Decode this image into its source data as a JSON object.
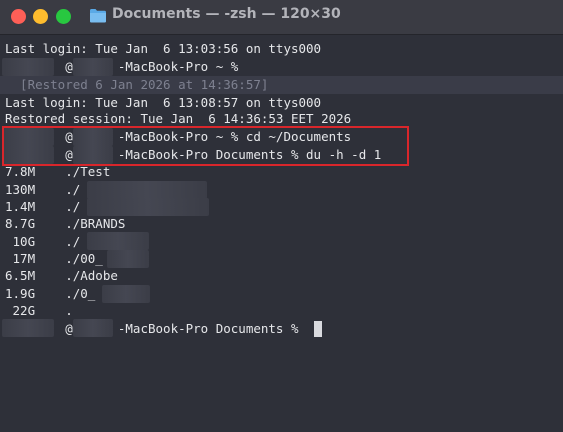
{
  "window": {
    "title": "Documents — -zsh — 120×30",
    "folder_icon": "folder-icon"
  },
  "colors": {
    "background": "#2e3039",
    "text": "#e6e7ea",
    "restored": "#7e8190",
    "highlight": "#d9262b"
  },
  "terminal": {
    "lines": [
      "Last login: Tue Jan  6 13:03:56 on ttys000",
      "        @M     -MacBook-Pro ~ %",
      "  [Restored 6 Jan 2026 at 14:36:57]",
      "Last login: Tue Jan  6 13:08:57 on ttys000",
      "Restored session: Tue Jan  6 14:36:53 EET 2026",
      "        @M     -MacBook-Pro ~ % cd ~/Documents",
      "        @M     -MacBook-Pro Documents % du -h -d 1",
      "7.8M    ./Test",
      "130M    ./",
      "1.4M    ./",
      "8.7G    ./BRANDS",
      " 10G    ./",
      " 17M    ./00_",
      "6.5M    ./Adobe",
      "1.9G    ./0_",
      " 22G    .",
      "        @M     -MacBook-Pro Documents % "
    ]
  }
}
